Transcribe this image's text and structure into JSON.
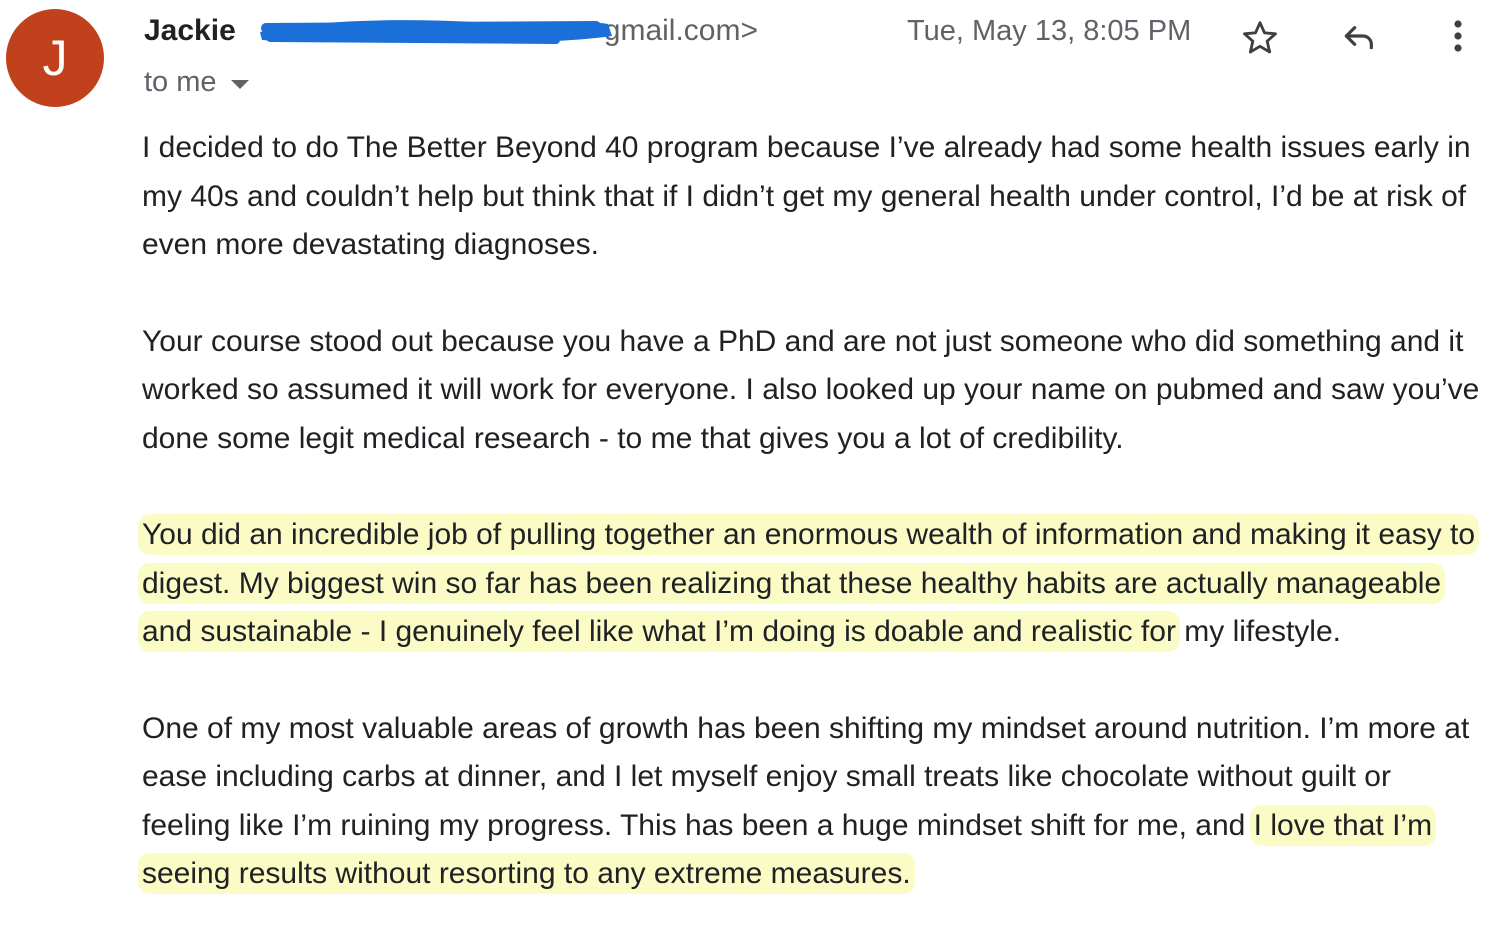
{
  "sender": {
    "avatar_letter": "J",
    "name": "Jackie",
    "email_visible": "gmail.com>",
    "redacted": true
  },
  "recipient": {
    "label": "to me"
  },
  "datetime": "Tue, May 13, 8:05 PM",
  "actions": {
    "star_icon": "star-outline-icon",
    "reply_icon": "reply-arrow-icon",
    "more_icon": "more-vertical-icon"
  },
  "message": {
    "p1": "I decided to do The Better Beyond 40 program because I’ve already had some health issues early in my 40s and couldn’t help but think that if I didn’t get  my general health under control, I’d be at risk of even more devastating diagnoses.",
    "p2": "Your course stood out because you have a PhD and are not just someone who did something and it worked so assumed it will work for everyone. I also looked up your name on pubmed and saw you’ve done some legit medical research - to me that gives you a lot of credibility.",
    "p3_highlight": "You did an incredible job of pulling together an enormous wealth of information and making it easy to digest. My biggest win so far has been realizing that these healthy habits are actually manageable and sustainable - I genuinely feel like what I’m doing is doable and realistic for",
    "p3_rest": " my lifestyle.",
    "p4_start": "One of my most valuable areas of growth has been shifting my mindset around nutrition. I’m more at ease including carbs at dinner, and I let myself enjoy small treats like chocolate without guilt or feeling like I’m ruining my progress. This has been a huge mindset shift for me, and ",
    "p4_highlight": "I love that I’m seeing results without resorting to any extreme measures."
  },
  "colors": {
    "avatar": "#c0411b",
    "highlight": "#fbfbc6",
    "redaction": "#1a6fd8",
    "text": "#202124",
    "secondary": "#5f6368"
  }
}
